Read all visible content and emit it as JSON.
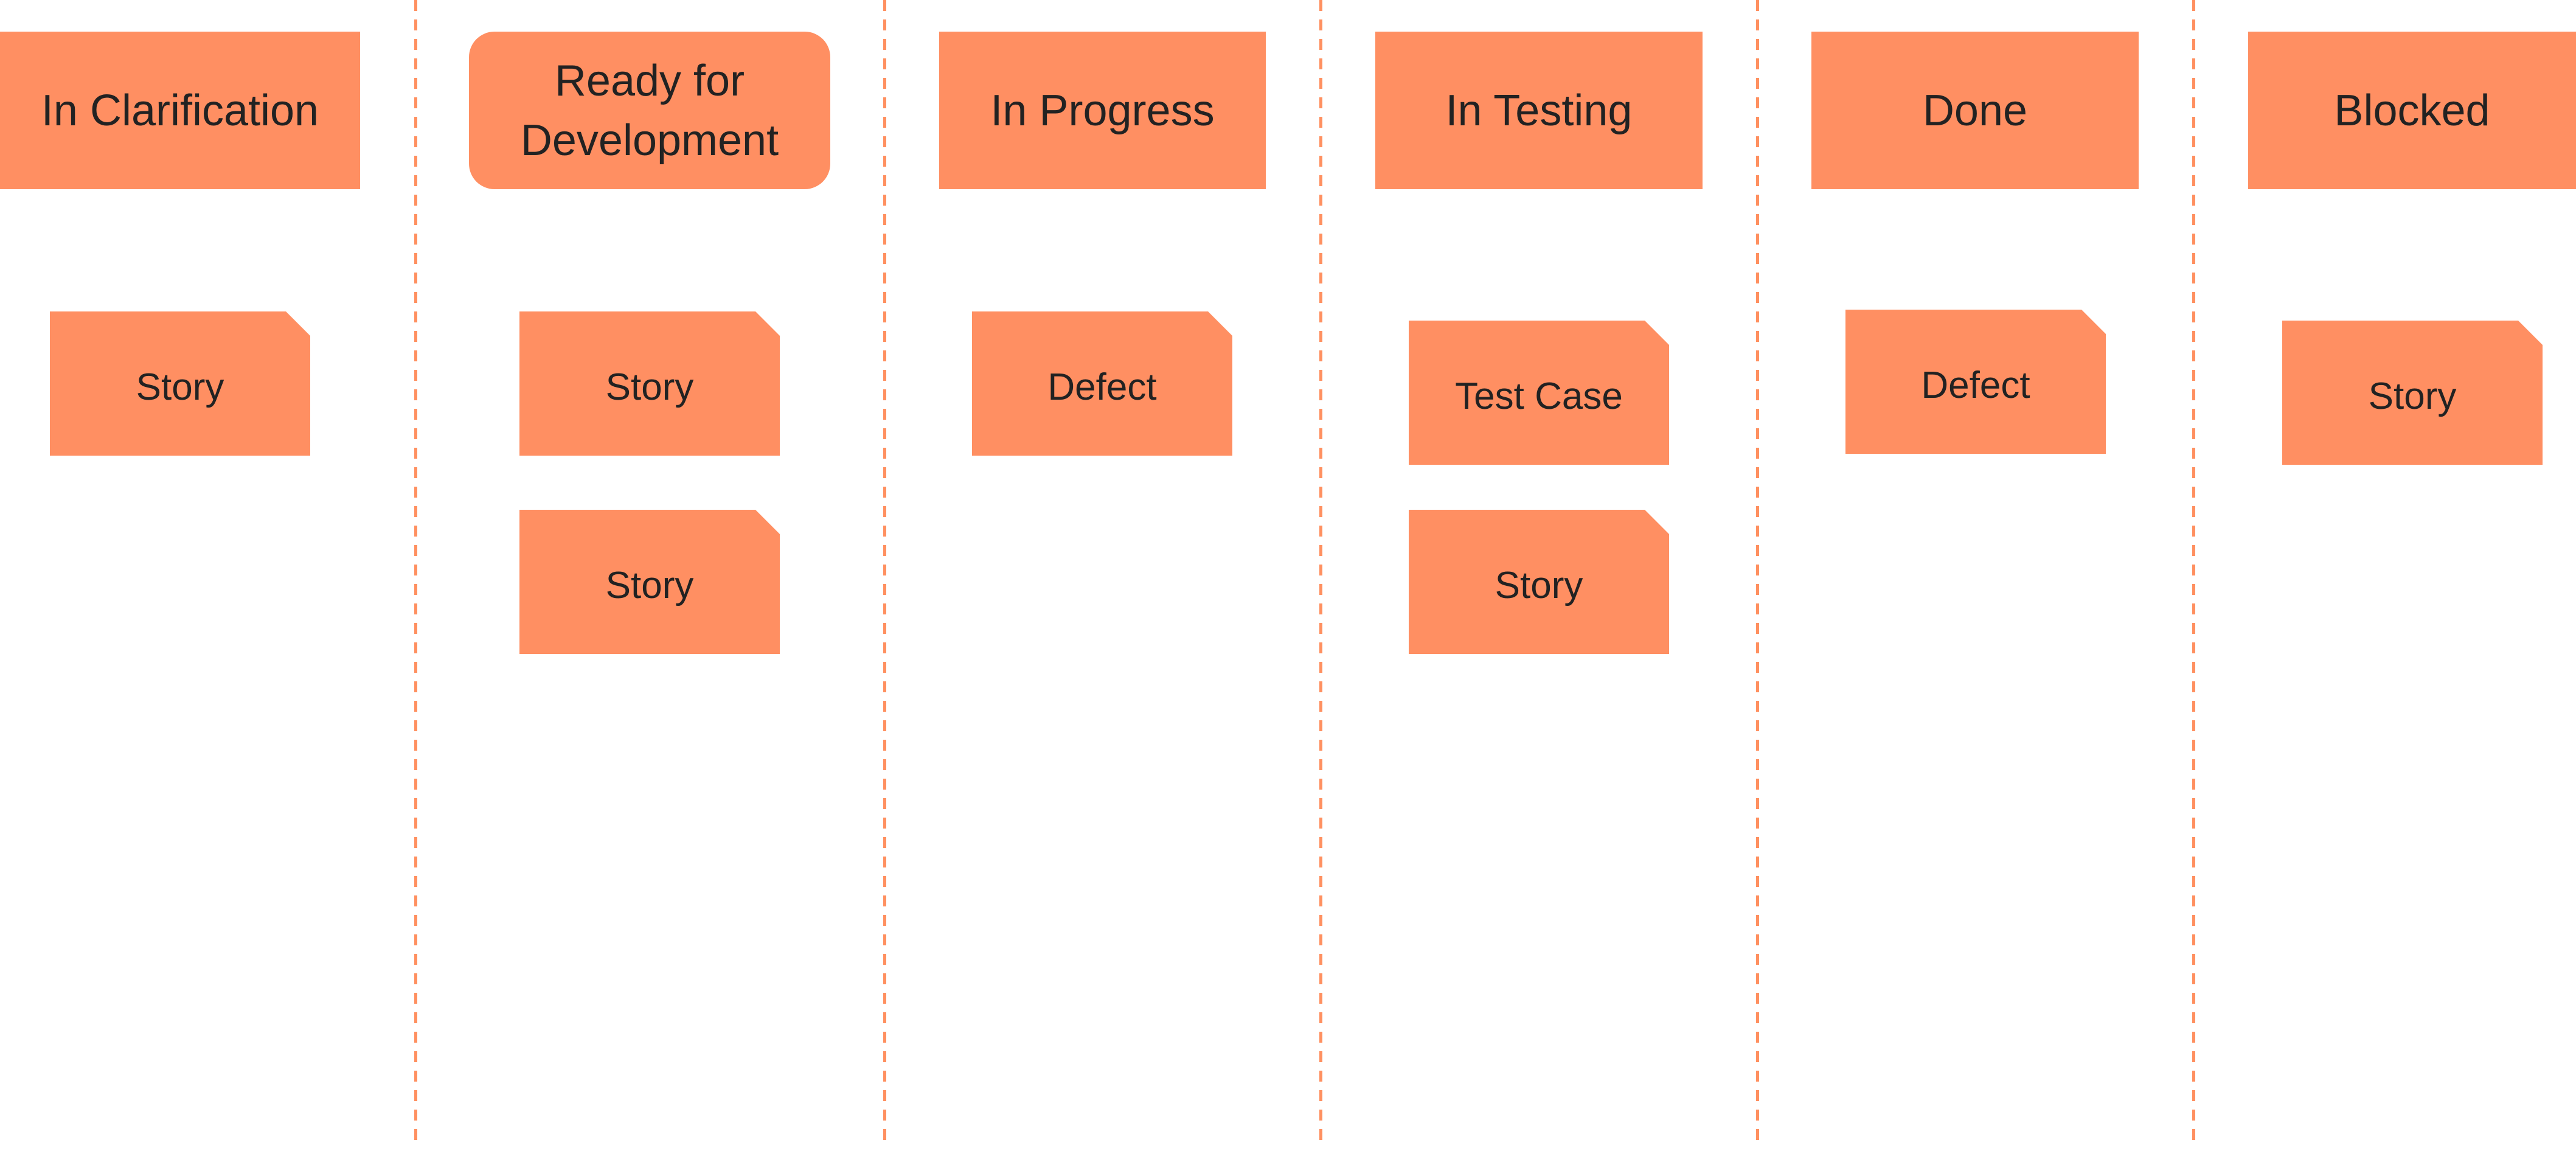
{
  "board": {
    "accent_color": "#ff8f62",
    "divider_color": "#ff9060",
    "text_color": "#222222",
    "columns": [
      {
        "title": "In Clarification",
        "cards": [
          {
            "type": "Story"
          }
        ]
      },
      {
        "title": "Ready for\nDevelopment",
        "cards": [
          {
            "type": "Story"
          },
          {
            "type": "Story"
          }
        ]
      },
      {
        "title": "In Progress",
        "cards": [
          {
            "type": "Defect"
          }
        ]
      },
      {
        "title": "In Testing",
        "cards": [
          {
            "type": "Test Case"
          },
          {
            "type": "Story"
          }
        ]
      },
      {
        "title": "Done",
        "cards": [
          {
            "type": "Defect"
          }
        ]
      },
      {
        "title": "Blocked",
        "cards": [
          {
            "type": "Story"
          }
        ]
      }
    ]
  }
}
